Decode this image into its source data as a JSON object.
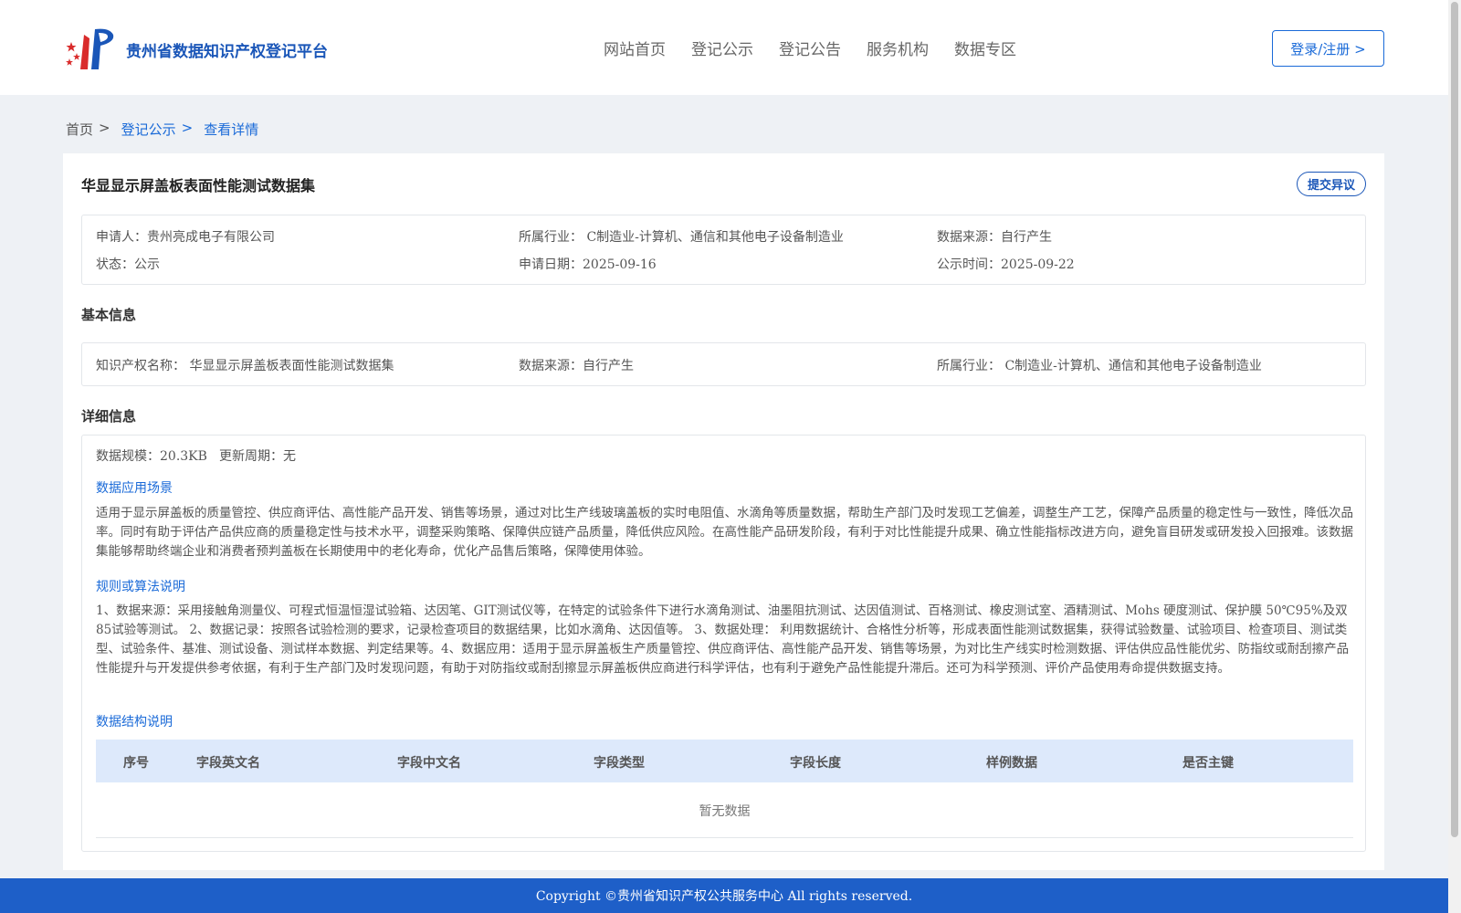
{
  "header": {
    "brand": "贵州省数据知识产权登记平台",
    "nav": [
      "网站首页",
      "登记公示",
      "登记公告",
      "服务机构",
      "数据专区"
    ],
    "login_label": "登录/注册 >"
  },
  "breadcrumb": {
    "home": "首页",
    "sep": ">",
    "level1": "登记公示",
    "level2": "查看详情"
  },
  "detail": {
    "title": "华显显示屏盖板表面性能测试数据集",
    "objection_label": "提交异议",
    "summary": {
      "applicant": "申请人：贵州亮成电子有限公司",
      "industry": "所属行业： C制造业-计算机、通信和其他电子设备制造业",
      "source": "数据来源：自行产生",
      "status": "状态：公示",
      "apply_date": "申请日期：2025-09-16",
      "publish_date": "公示时间：2025-09-22"
    },
    "basic_title": "基本信息",
    "basic": {
      "ip_name": "知识产权名称： 华显显示屏盖板表面性能测试数据集",
      "source": "数据来源：自行产生",
      "industry": "所属行业： C制造业-计算机、通信和其他电子设备制造业"
    },
    "detail_title": "详细信息",
    "scale": "数据规模：20.3KB",
    "update_cycle": "更新周期：无",
    "scenario_title": "数据应用场景",
    "scenario_text": "适用于显示屏盖板的质量管控、供应商评估、高性能产品开发、销售等场景，通过对比生产线玻璃盖板的实时电阻值、水滴角等质量数据，帮助生产部门及时发现工艺偏差，调整生产工艺，保障产品质量的稳定性与一致性，降低次品率。同时有助于评估产品供应商的质量稳定性与技术水平，调整采购策略、保障供应链产品质量，降低供应风险。在高性能产品研发阶段，有利于对比性能提升成果、确立性能指标改进方向，避免盲目研发或研发投入回报难。该数据集能够帮助终端企业和消费者预判盖板在长期使用中的老化寿命，优化产品售后策略，保障使用体验。",
    "rule_title": "规则或算法说明",
    "rule_text": "1、数据来源：采用接触角测量仪、可程式恒温恒湿试验箱、达因笔、GIT测试仪等，在特定的试验条件下进行水滴角测试、油墨阻抗测试、达因值测试、百格测试、橡皮测试室、酒精测试、Mohs 硬度测试、保护膜 50℃95%及双85试验等测试。 2、数据记录：按照各试验检测的要求，记录检查项目的数据结果，比如水滴角、达因值等。 3、数据处理： 利用数据统计、合格性分析等，形成表面性能测试数据集，获得试验数量、试验项目、检查项目、测试类型、试验条件、基准、测试设备、测试样本数据、判定结果等。4、数据应用：适用于显示屏盖板生产质量管控、供应商评估、高性能产品开发、销售等场景，为对比生产线实时检测数据、评估供应品性能优劣、防指纹或耐刮擦产品性能提升与开发提供参考依据，有利于生产部门及时发现问题，有助于对防指纹或耐刮擦显示屏盖板供应商进行科学评估，也有利于避免产品性能提升滞后。还可为科学预测、评价产品使用寿命提供数据支持。",
    "structure_title": "数据结构说明",
    "table_headers": [
      "序号",
      "字段英文名",
      "字段中文名",
      "字段类型",
      "字段长度",
      "样例数据",
      "是否主键"
    ],
    "table_empty": "暂无数据"
  },
  "footer": {
    "copyright": "Copyright ©贵州省知识产权公共服务中心 All rights reserved."
  },
  "colors": {
    "brand_blue": "#1a56b8",
    "link_blue": "#1a6ad8",
    "footer_blue": "#1e5fc8",
    "table_header_bg": "#dde9fb"
  }
}
